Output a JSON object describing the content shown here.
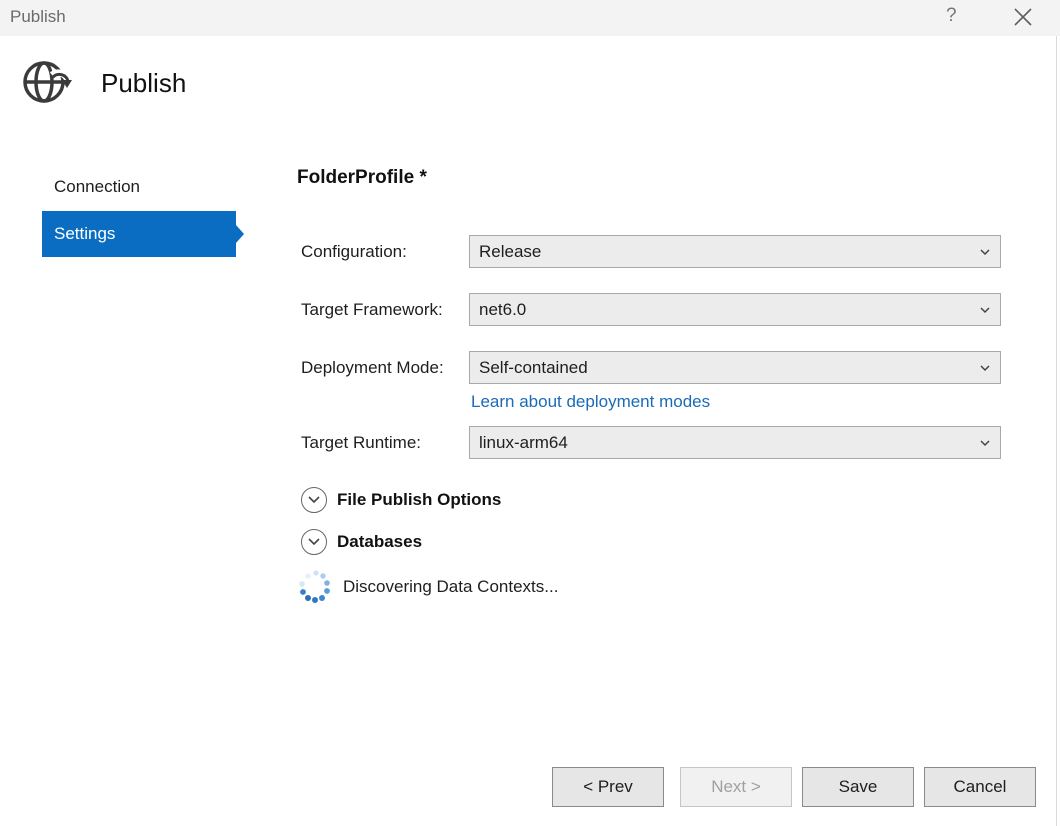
{
  "window": {
    "title": "Publish",
    "help": "?"
  },
  "header": {
    "title": "Publish",
    "icon": "globe-publish-icon"
  },
  "nav": {
    "items": [
      {
        "label": "Connection",
        "selected": false
      },
      {
        "label": "Settings",
        "selected": true
      }
    ]
  },
  "profile": {
    "title": "FolderProfile *"
  },
  "fields": {
    "configuration": {
      "label": "Configuration:",
      "value": "Release"
    },
    "target_framework": {
      "label": "Target Framework:",
      "value": "net6.0"
    },
    "deployment_mode": {
      "label": "Deployment Mode:",
      "value": "Self-contained",
      "help_link": "Learn about deployment modes"
    },
    "target_runtime": {
      "label": "Target Runtime:",
      "value": "linux-arm64"
    }
  },
  "sections": {
    "file_publish_options": "File Publish Options",
    "databases": "Databases"
  },
  "status": {
    "text": "Discovering Data Contexts..."
  },
  "buttons": {
    "prev": "< Prev",
    "next": "Next >",
    "save": "Save",
    "cancel": "Cancel"
  },
  "colors": {
    "accent": "#0a6dc2",
    "link": "#1a6bb8"
  }
}
